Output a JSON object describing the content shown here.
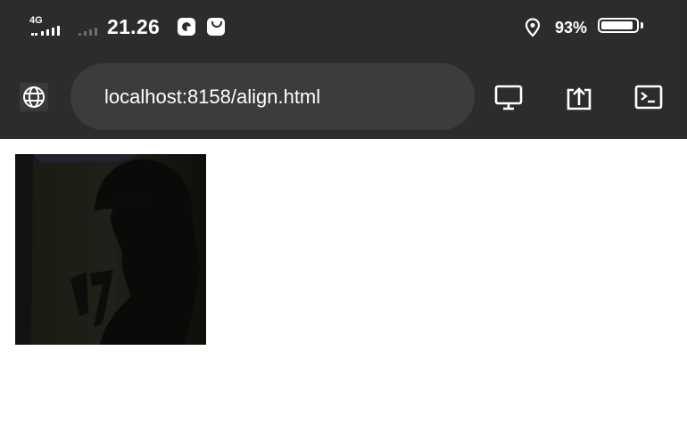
{
  "status_bar": {
    "network_type": "4G",
    "time": "21.26",
    "battery_percent_text": "93%",
    "battery_level": 0.93
  },
  "browser": {
    "url": "localhost:8158/align.html"
  },
  "icons": {
    "site_info": "globe-icon",
    "desktop_mode": "monitor-icon",
    "share": "share-icon",
    "console": "terminal-icon"
  }
}
